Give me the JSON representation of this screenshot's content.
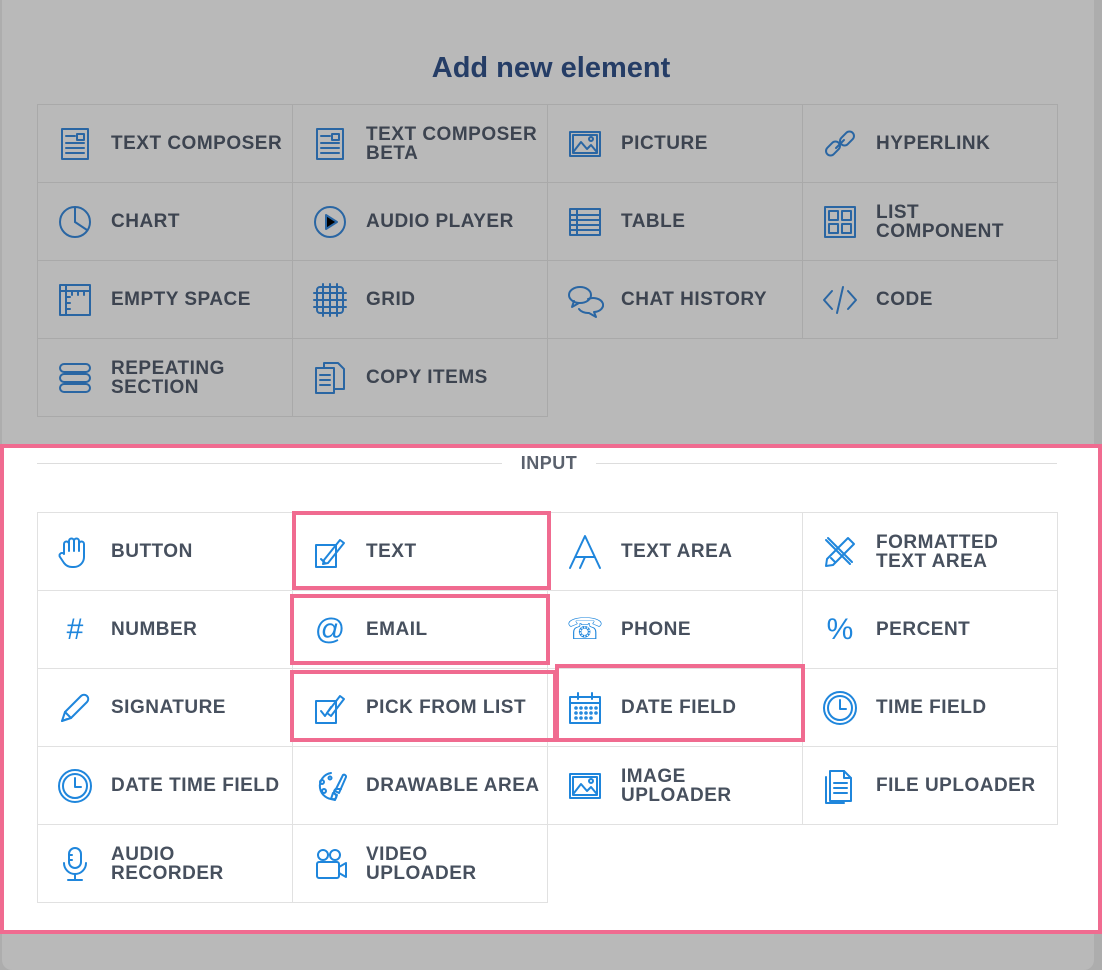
{
  "dialog": {
    "title": "Add new element"
  },
  "layout_elements": [
    {
      "label": "TEXT COMPOSER",
      "icon": "text-composer-icon"
    },
    {
      "label": "TEXT COMPOSER\nBETA",
      "icon": "text-composer-beta-icon"
    },
    {
      "label": "PICTURE",
      "icon": "picture-icon"
    },
    {
      "label": "HYPERLINK",
      "icon": "link-icon"
    },
    {
      "label": "CHART",
      "icon": "pie-chart-icon"
    },
    {
      "label": "AUDIO PLAYER",
      "icon": "play-icon"
    },
    {
      "label": "TABLE",
      "icon": "table-icon"
    },
    {
      "label": "LIST\nCOMPONENT",
      "icon": "grid-list-icon"
    },
    {
      "label": "EMPTY SPACE",
      "icon": "ruler-icon"
    },
    {
      "label": "GRID",
      "icon": "grid-icon"
    },
    {
      "label": "CHAT HISTORY",
      "icon": "chat-bubbles-icon"
    },
    {
      "label": "CODE",
      "icon": "code-icon"
    },
    {
      "label": "REPEATING\nSECTION",
      "icon": "stack-icon"
    },
    {
      "label": "COPY ITEMS",
      "icon": "copy-documents-icon"
    }
  ],
  "input_section": {
    "title": "INPUT",
    "items": [
      {
        "label": "BUTTON",
        "icon": "hand-icon"
      },
      {
        "label": "TEXT",
        "icon": "pencil-box-icon"
      },
      {
        "label": "TEXT AREA",
        "icon": "letter-a-icon"
      },
      {
        "label": "FORMATTED\nTEXT AREA",
        "icon": "format-tools-icon"
      },
      {
        "label": "NUMBER",
        "icon": "hash-icon"
      },
      {
        "label": "EMAIL",
        "icon": "at-sign-icon"
      },
      {
        "label": "PHONE",
        "icon": "phone-icon"
      },
      {
        "label": "PERCENT",
        "icon": "percent-icon"
      },
      {
        "label": "SIGNATURE",
        "icon": "pen-icon"
      },
      {
        "label": "PICK FROM LIST",
        "icon": "checkbox-pencil-icon"
      },
      {
        "label": "DATE FIELD",
        "icon": "calendar-icon"
      },
      {
        "label": "TIME FIELD",
        "icon": "clock-icon"
      },
      {
        "label": "DATE TIME FIELD",
        "icon": "clock-icon"
      },
      {
        "label": "DRAWABLE AREA",
        "icon": "palette-brush-icon"
      },
      {
        "label": "IMAGE\nUPLOADER",
        "icon": "picture-icon"
      },
      {
        "label": "FILE UPLOADER",
        "icon": "file-icon"
      },
      {
        "label": "AUDIO\nRECORDER",
        "icon": "microphone-icon"
      },
      {
        "label": "VIDEO\nUPLOADER",
        "icon": "video-camera-icon"
      }
    ]
  },
  "highlights": [
    "TEXT",
    "EMAIL",
    "PICK FROM LIST",
    "DATE FIELD"
  ],
  "colors": {
    "highlight": "#f06b90",
    "icon_blue": "#1f86dc",
    "title_navy": "#253d66",
    "overlay_gray": "#b9b9b9"
  }
}
